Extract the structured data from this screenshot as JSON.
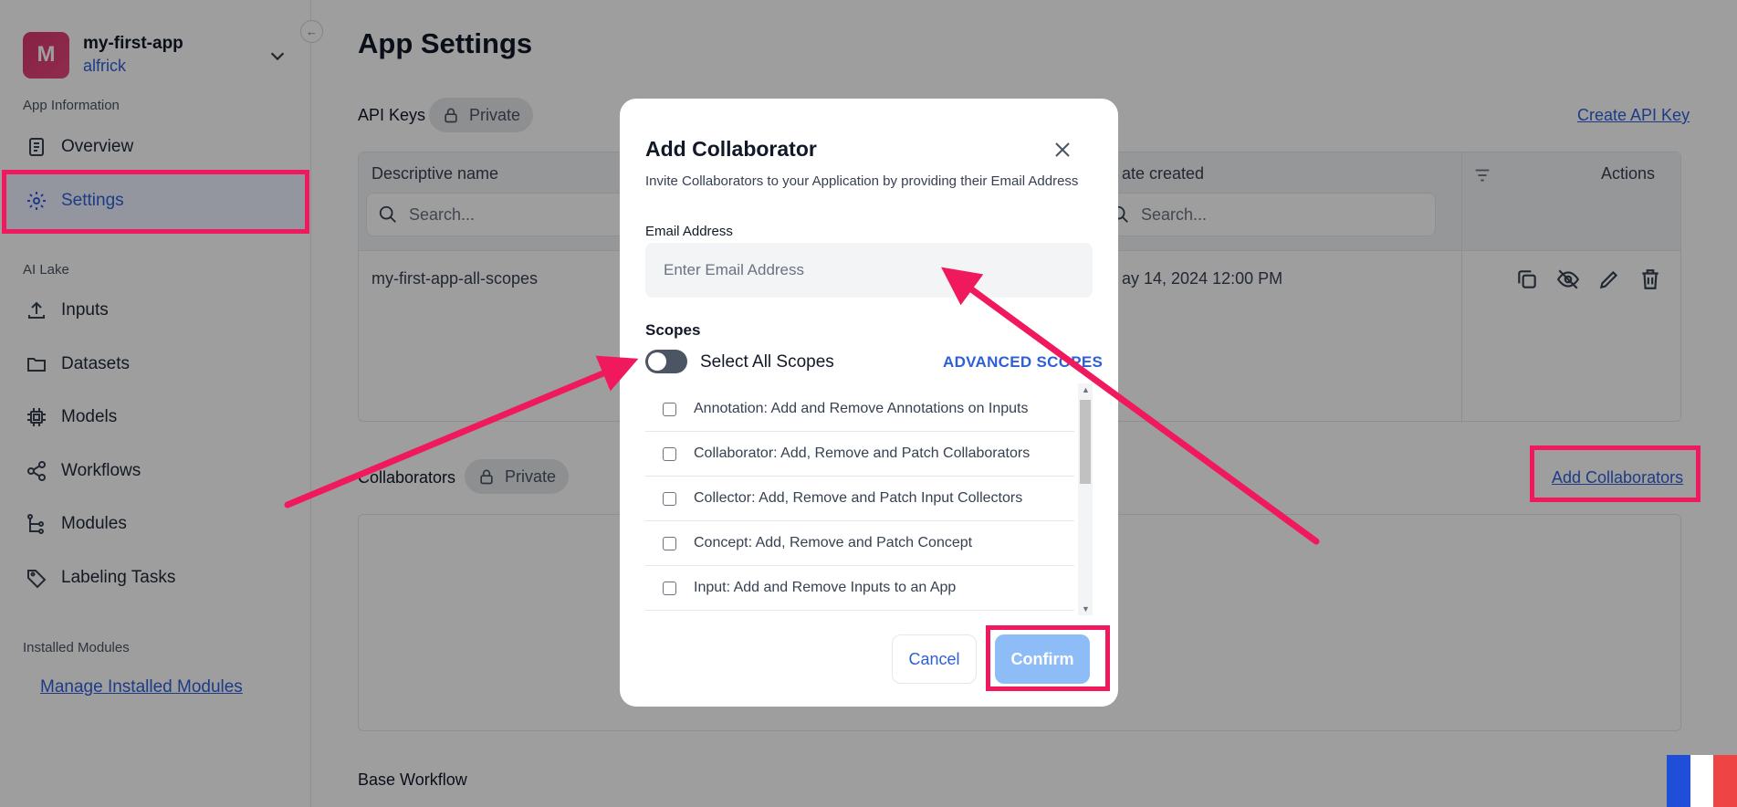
{
  "sidebar": {
    "avatar_letter": "M",
    "app_name": "my-first-app",
    "owner": "alfrick",
    "section_app_info": "App Information",
    "nav_overview": "Overview",
    "nav_settings": "Settings",
    "section_ai_lake": "AI Lake",
    "nav_inputs": "Inputs",
    "nav_datasets": "Datasets",
    "nav_models": "Models",
    "nav_workflows": "Workflows",
    "nav_modules": "Modules",
    "nav_labeling": "Labeling Tasks",
    "section_installed": "Installed Modules",
    "manage_link": "Manage Installed Modules"
  },
  "main": {
    "title": "App Settings",
    "api_keys_label": "API Keys",
    "private_label": "Private",
    "create_api_key": "Create API Key",
    "col_name": "Descriptive name",
    "col_date": "ate created",
    "col_actions": "Actions",
    "search_placeholder": "Search...",
    "row_name": "my-first-app-all-scopes",
    "row_date": "ay 14, 2024 12:00 PM",
    "collaborators_label": "Collaborators",
    "add_collaborators": "Add Collaborators",
    "base_workflow": "Base Workflow"
  },
  "modal": {
    "title": "Add Collaborator",
    "description": "Invite Collaborators to your Application by providing their Email Address",
    "email_label": "Email Address",
    "email_placeholder": "Enter Email Address",
    "scopes_label": "Scopes",
    "select_all_label": "Select All Scopes",
    "advanced_scopes": "ADVANCED SCOPES",
    "scopes": [
      "Annotation: Add and Remove Annotations on Inputs",
      "Collaborator: Add, Remove and Patch Collaborators",
      "Collector: Add, Remove and Patch Input Collectors",
      "Concept: Add, Remove and Patch Concept",
      "Input: Add and Remove Inputs to an App"
    ],
    "cancel_label": "Cancel",
    "confirm_label": "Confirm"
  },
  "colors": {
    "accent": "#2f5fd8",
    "highlight": "#f0195e",
    "confirm_disabled": "#8ebcf7"
  }
}
